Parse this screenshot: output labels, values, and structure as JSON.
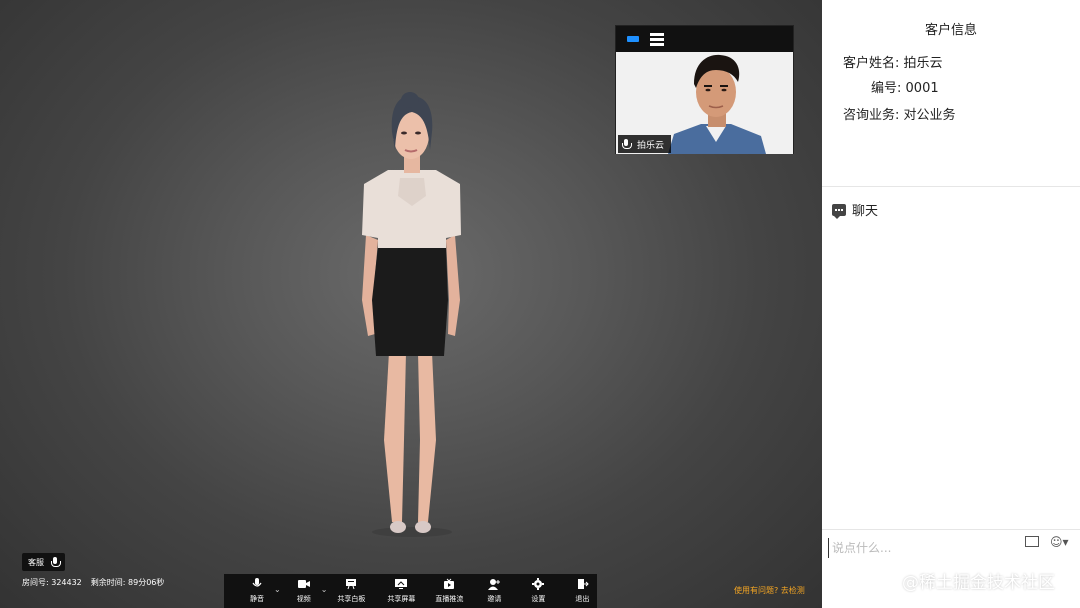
{
  "customer_info": {
    "title": "客户信息",
    "name_label": "客户姓名:",
    "name_value": "拍乐云",
    "id_label": "编号:",
    "id_value": "0001",
    "business_label": "咨询业务:",
    "business_value": "对公业务"
  },
  "chat": {
    "title": "聊天",
    "input_placeholder": "说点什么..."
  },
  "pip": {
    "participant_name": "拍乐云"
  },
  "local": {
    "role": "客服"
  },
  "room": {
    "room_label": "房间号: 324432",
    "time_label": "剩余时间: 89分06秒"
  },
  "toolbar": {
    "mute": "静音",
    "video": "视频",
    "whiteboard": "共享白板",
    "share_screen": "共享屏幕",
    "stream": "直播推流",
    "invite": "邀请",
    "settings": "设置",
    "exit": "退出"
  },
  "help_link": "使用有问题? 去检测",
  "watermark": "@稀土掘金技术社区",
  "colors": {
    "accent_blue": "#1e90ff",
    "help_orange": "#f5a623",
    "toolbar_bg": "#111111"
  }
}
